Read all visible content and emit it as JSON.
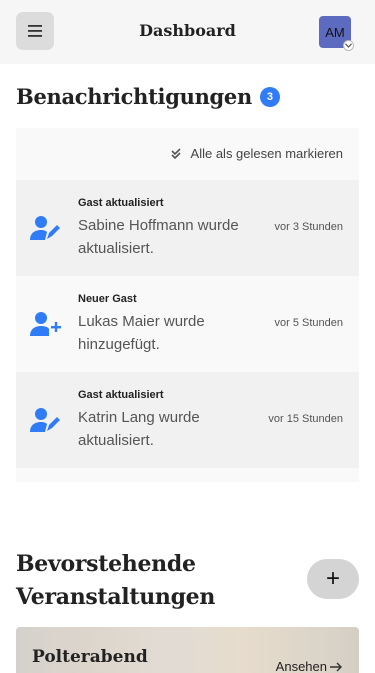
{
  "header": {
    "title": "Dashboard",
    "avatar_initials": "AM",
    "menu_icon": "hamburger-icon"
  },
  "notifications": {
    "title": "Benachrichtigungen",
    "count": "3",
    "mark_all_label": "Alle als gelesen markieren",
    "items": [
      {
        "type": "Gast aktualisiert",
        "message": "Sabine Hoffmann wurde aktualisiert.",
        "time": "vor 3 Stunden",
        "icon": "user-edit-icon"
      },
      {
        "type": "Neuer Gast",
        "message": "Lukas Maier wurde hinzugefügt.",
        "time": "vor 5 Stunden",
        "icon": "user-add-icon"
      },
      {
        "type": "Gast aktualisiert",
        "message": "Katrin Lang wurde aktualisiert.",
        "time": "vor 15 Stunden",
        "icon": "user-edit-icon"
      }
    ]
  },
  "events": {
    "title": "Bevorstehende Veranstaltungen",
    "add_label": "+",
    "items": [
      {
        "name": "Polterabend",
        "link_label": "Ansehen"
      }
    ]
  },
  "colors": {
    "accent": "#2f7cf6",
    "avatar": "#5c6bc0"
  }
}
